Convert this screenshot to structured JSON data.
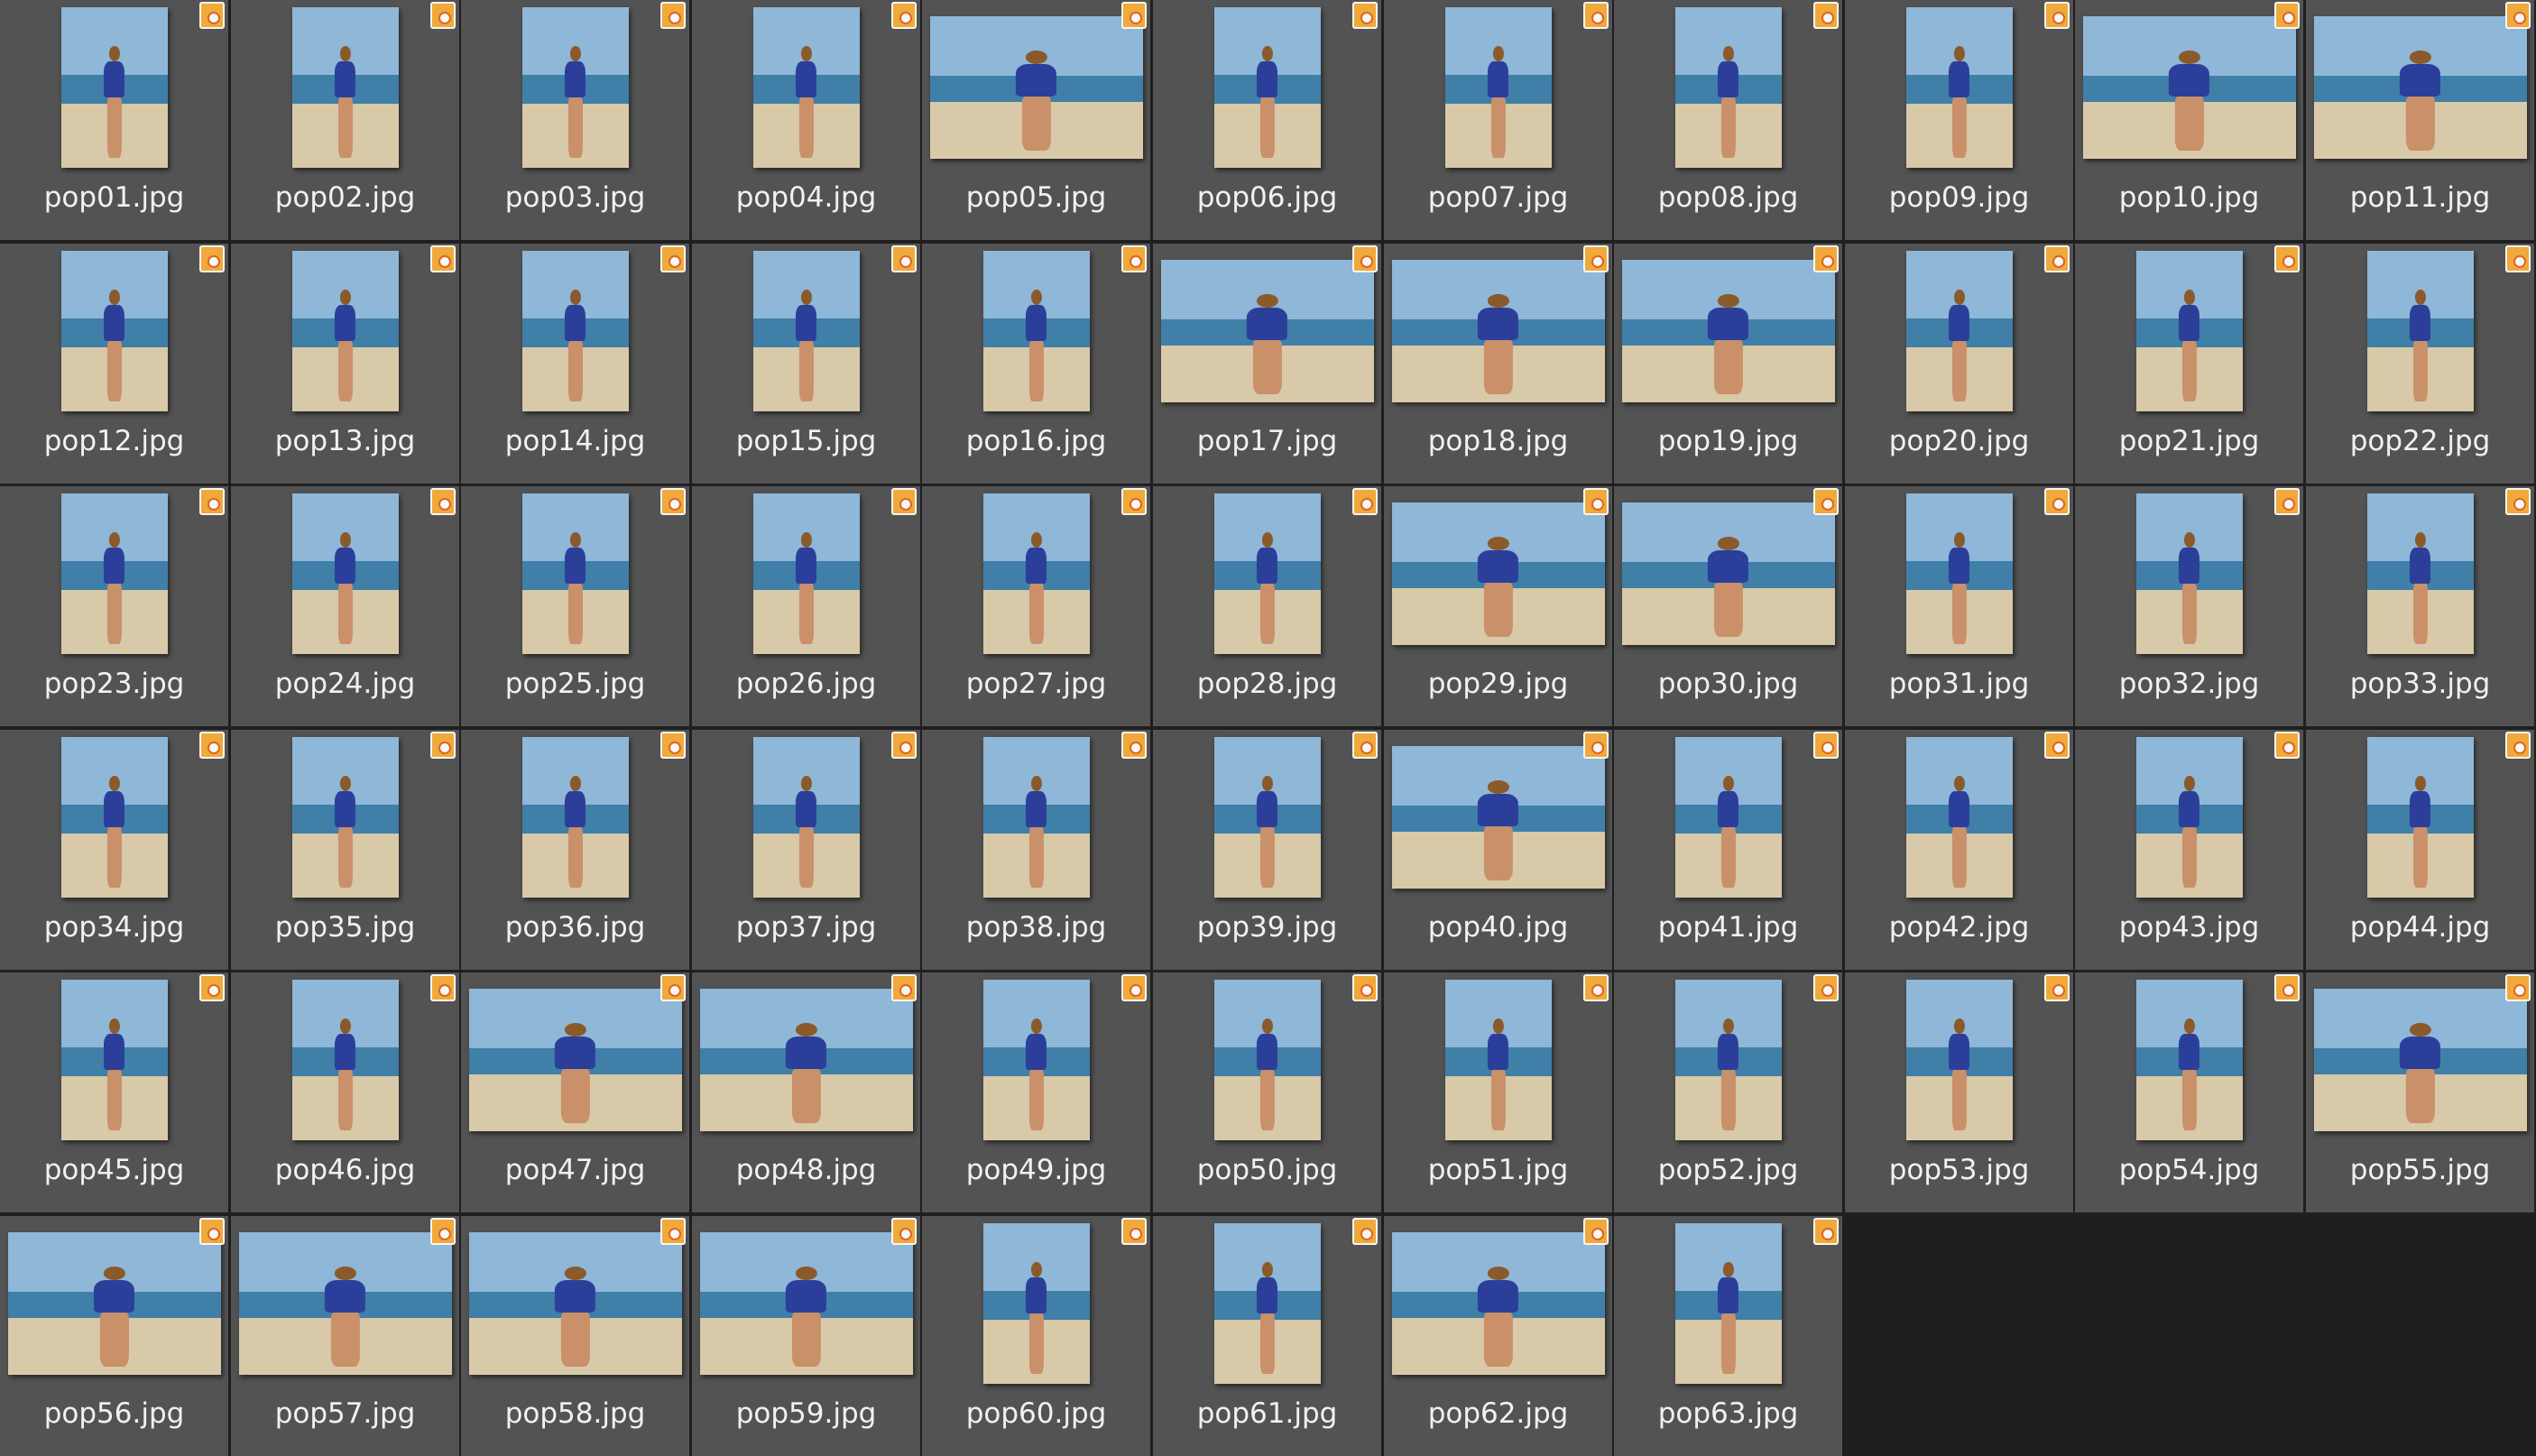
{
  "window_title": "",
  "files": [
    {
      "name": "pop01.jpg",
      "orientation": "portrait"
    },
    {
      "name": "pop02.jpg",
      "orientation": "portrait"
    },
    {
      "name": "pop03.jpg",
      "orientation": "portrait"
    },
    {
      "name": "pop04.jpg",
      "orientation": "portrait"
    },
    {
      "name": "pop05.jpg",
      "orientation": "landscape"
    },
    {
      "name": "pop06.jpg",
      "orientation": "portrait"
    },
    {
      "name": "pop07.jpg",
      "orientation": "portrait"
    },
    {
      "name": "pop08.jpg",
      "orientation": "portrait"
    },
    {
      "name": "pop09.jpg",
      "orientation": "portrait"
    },
    {
      "name": "pop10.jpg",
      "orientation": "landscape"
    },
    {
      "name": "pop11.jpg",
      "orientation": "landscape"
    },
    {
      "name": "pop12.jpg",
      "orientation": "portrait"
    },
    {
      "name": "pop13.jpg",
      "orientation": "portrait"
    },
    {
      "name": "pop14.jpg",
      "orientation": "portrait"
    },
    {
      "name": "pop15.jpg",
      "orientation": "portrait"
    },
    {
      "name": "pop16.jpg",
      "orientation": "portrait"
    },
    {
      "name": "pop17.jpg",
      "orientation": "landscape"
    },
    {
      "name": "pop18.jpg",
      "orientation": "landscape"
    },
    {
      "name": "pop19.jpg",
      "orientation": "landscape"
    },
    {
      "name": "pop20.jpg",
      "orientation": "portrait"
    },
    {
      "name": "pop21.jpg",
      "orientation": "portrait"
    },
    {
      "name": "pop22.jpg",
      "orientation": "portrait"
    },
    {
      "name": "pop23.jpg",
      "orientation": "portrait"
    },
    {
      "name": "pop24.jpg",
      "orientation": "portrait"
    },
    {
      "name": "pop25.jpg",
      "orientation": "portrait"
    },
    {
      "name": "pop26.jpg",
      "orientation": "portrait"
    },
    {
      "name": "pop27.jpg",
      "orientation": "portrait"
    },
    {
      "name": "pop28.jpg",
      "orientation": "portrait"
    },
    {
      "name": "pop29.jpg",
      "orientation": "landscape"
    },
    {
      "name": "pop30.jpg",
      "orientation": "landscape"
    },
    {
      "name": "pop31.jpg",
      "orientation": "portrait"
    },
    {
      "name": "pop32.jpg",
      "orientation": "portrait"
    },
    {
      "name": "pop33.jpg",
      "orientation": "portrait"
    },
    {
      "name": "pop34.jpg",
      "orientation": "portrait"
    },
    {
      "name": "pop35.jpg",
      "orientation": "portrait"
    },
    {
      "name": "pop36.jpg",
      "orientation": "portrait"
    },
    {
      "name": "pop37.jpg",
      "orientation": "portrait"
    },
    {
      "name": "pop38.jpg",
      "orientation": "portrait"
    },
    {
      "name": "pop39.jpg",
      "orientation": "portrait"
    },
    {
      "name": "pop40.jpg",
      "orientation": "landscape"
    },
    {
      "name": "pop41.jpg",
      "orientation": "portrait"
    },
    {
      "name": "pop42.jpg",
      "orientation": "portrait"
    },
    {
      "name": "pop43.jpg",
      "orientation": "portrait"
    },
    {
      "name": "pop44.jpg",
      "orientation": "portrait"
    },
    {
      "name": "pop45.jpg",
      "orientation": "portrait"
    },
    {
      "name": "pop46.jpg",
      "orientation": "portrait"
    },
    {
      "name": "pop47.jpg",
      "orientation": "landscape"
    },
    {
      "name": "pop48.jpg",
      "orientation": "landscape"
    },
    {
      "name": "pop49.jpg",
      "orientation": "portrait"
    },
    {
      "name": "pop50.jpg",
      "orientation": "portrait"
    },
    {
      "name": "pop51.jpg",
      "orientation": "portrait"
    },
    {
      "name": "pop52.jpg",
      "orientation": "portrait"
    },
    {
      "name": "pop53.jpg",
      "orientation": "portrait"
    },
    {
      "name": "pop54.jpg",
      "orientation": "portrait"
    },
    {
      "name": "pop55.jpg",
      "orientation": "landscape"
    },
    {
      "name": "pop56.jpg",
      "orientation": "landscape"
    },
    {
      "name": "pop57.jpg",
      "orientation": "landscape"
    },
    {
      "name": "pop58.jpg",
      "orientation": "landscape"
    },
    {
      "name": "pop59.jpg",
      "orientation": "landscape"
    },
    {
      "name": "pop60.jpg",
      "orientation": "portrait"
    },
    {
      "name": "pop61.jpg",
      "orientation": "portrait"
    },
    {
      "name": "pop62.jpg",
      "orientation": "landscape"
    },
    {
      "name": "pop63.jpg",
      "orientation": "portrait"
    }
  ],
  "badge_icon": "jpg-file-type-icon",
  "colors": {
    "tile_background": "#535353",
    "empty_background": "#1f1f1f",
    "label_text": "#f1f1f1",
    "badge": "#f0a93b",
    "sky": "#8fb7d8",
    "sea": "#3f7fa8",
    "sand": "#d8c9a8",
    "outfit": "#2b3f9a",
    "skin": "#c9906a",
    "hair": "#8a5a2b"
  }
}
